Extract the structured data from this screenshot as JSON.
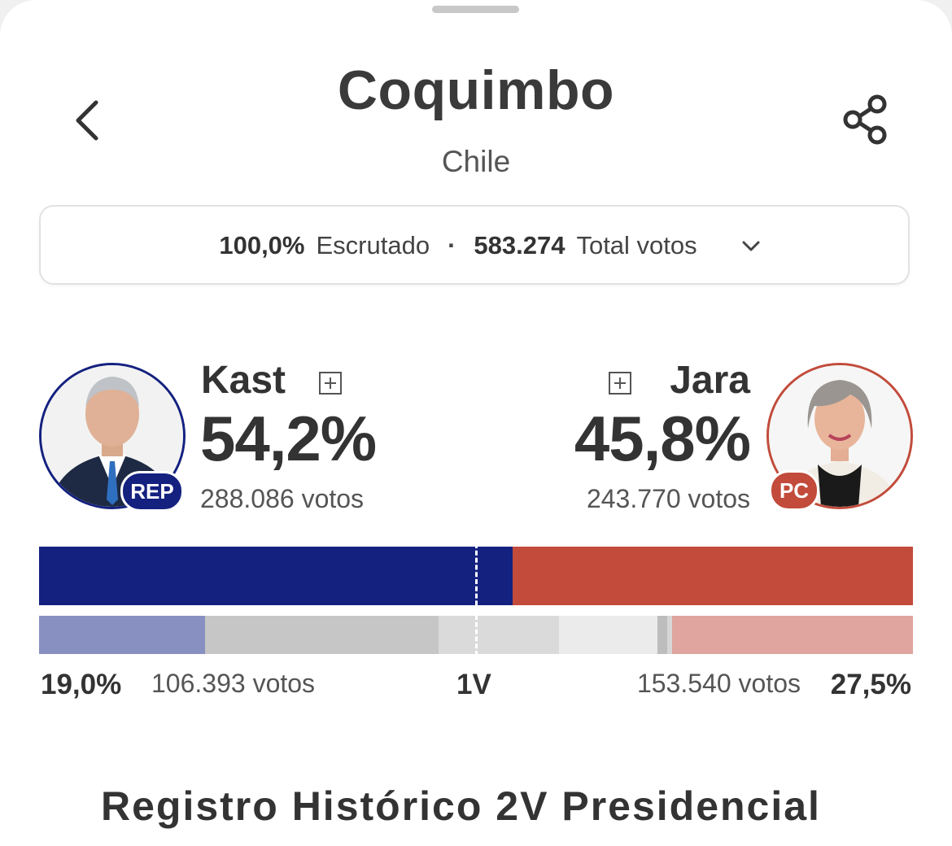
{
  "header": {
    "title": "Coquimbo",
    "subtitle": "Chile"
  },
  "summary": {
    "scrutinized_pct": "100,0%",
    "scrutinized_label": "Escrutado",
    "separator": "·",
    "total_votes": "583.274",
    "total_label": "Total votos"
  },
  "candidates": [
    {
      "name": "Kast",
      "percent": "54,2%",
      "votes": "288.086 votos",
      "party": "REP",
      "color": "#14217f"
    },
    {
      "name": "Jara",
      "percent": "45,8%",
      "votes": "243.770 votos",
      "party": "PC",
      "color": "#c24b3b"
    }
  ],
  "first_round": {
    "label": "1V",
    "left_pct": "19,0%",
    "left_votes": "106.393 votos",
    "right_votes": "153.540 votos",
    "right_pct": "27,5%"
  },
  "bars": {
    "main": [
      {
        "share": 0.542,
        "color": "#14217f"
      },
      {
        "share": 0.458,
        "color": "#c24b3b"
      }
    ],
    "first_round": [
      {
        "share": 0.19,
        "color": "#8890c2"
      },
      {
        "share": 0.266,
        "color": "#c6c6c6"
      },
      {
        "share": 0.138,
        "color": "#dadada"
      },
      {
        "share": 0.112,
        "color": "#ebebeb"
      },
      {
        "share": 0.011,
        "color": "#bdbdbd"
      },
      {
        "share": 0.006,
        "color": "#d6d6d6"
      },
      {
        "share": 0.275,
        "color": "#dfa59e"
      }
    ]
  },
  "next_section": {
    "heading": "Registro Histórico 2V Presidencial"
  },
  "icons": {
    "back": "chevron-left-icon",
    "share": "share-icon",
    "expand": "chevron-down-icon",
    "more": "plus-square-icon"
  }
}
